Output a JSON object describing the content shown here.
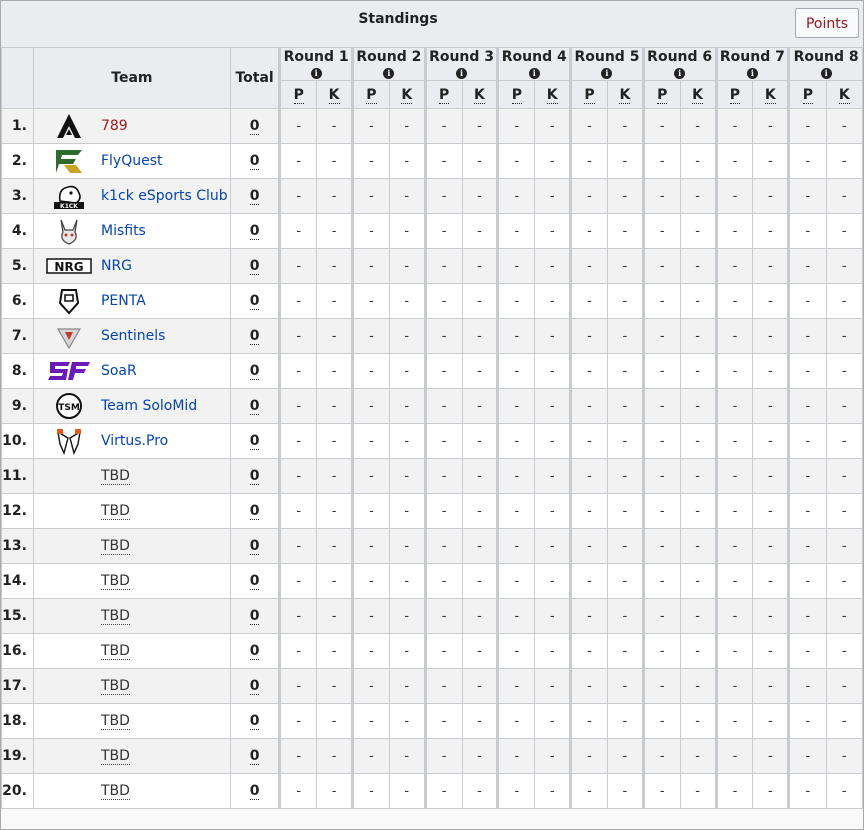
{
  "title": "Standings",
  "points_button": "Points",
  "header": {
    "team": "Team",
    "total": "Total",
    "info_glyph": "i",
    "p": "P",
    "k": "K"
  },
  "rounds": [
    "Round 1",
    "Round 2",
    "Round 3",
    "Round 4",
    "Round 5",
    "Round 6",
    "Round 7",
    "Round 8"
  ],
  "empty_cell": "-",
  "rows": [
    {
      "rank": "1.",
      "team": "789",
      "logo": "apex-789-logo",
      "total": "0",
      "color": "#a11a1a"
    },
    {
      "rank": "2.",
      "team": "FlyQuest",
      "logo": "flyquest-logo",
      "total": "0"
    },
    {
      "rank": "3.",
      "team": "k1ck eSports Club",
      "logo": "k1ck-logo",
      "total": "0"
    },
    {
      "rank": "4.",
      "team": "Misfits",
      "logo": "misfits-logo",
      "total": "0"
    },
    {
      "rank": "5.",
      "team": "NRG",
      "logo": "nrg-logo",
      "total": "0"
    },
    {
      "rank": "6.",
      "team": "PENTA",
      "logo": "penta-logo",
      "total": "0"
    },
    {
      "rank": "7.",
      "team": "Sentinels",
      "logo": "sentinels-logo",
      "total": "0"
    },
    {
      "rank": "8.",
      "team": "SoaR",
      "logo": "soar-logo",
      "total": "0"
    },
    {
      "rank": "9.",
      "team": "Team SoloMid",
      "logo": "tsm-logo",
      "total": "0"
    },
    {
      "rank": "10.",
      "team": "Virtus.Pro",
      "logo": "virtus-pro-logo",
      "total": "0"
    },
    {
      "rank": "11.",
      "team": "TBD",
      "logo": "",
      "total": "0"
    },
    {
      "rank": "12.",
      "team": "TBD",
      "logo": "",
      "total": "0"
    },
    {
      "rank": "13.",
      "team": "TBD",
      "logo": "",
      "total": "0"
    },
    {
      "rank": "14.",
      "team": "TBD",
      "logo": "",
      "total": "0"
    },
    {
      "rank": "15.",
      "team": "TBD",
      "logo": "",
      "total": "0"
    },
    {
      "rank": "16.",
      "team": "TBD",
      "logo": "",
      "total": "0"
    },
    {
      "rank": "17.",
      "team": "TBD",
      "logo": "",
      "total": "0"
    },
    {
      "rank": "18.",
      "team": "TBD",
      "logo": "",
      "total": "0"
    },
    {
      "rank": "19.",
      "team": "TBD",
      "logo": "",
      "total": "0"
    },
    {
      "rank": "20.",
      "team": "TBD",
      "logo": "",
      "total": "0"
    }
  ],
  "colors": {
    "link": "#0645ad",
    "highlight_team": "#a11a1a",
    "header_bg": "#eaecf0",
    "row_odd": "#f2f2f2",
    "row_even": "#ffffff",
    "border": "#c8ccd1",
    "points_button_text": "#8c2020"
  }
}
